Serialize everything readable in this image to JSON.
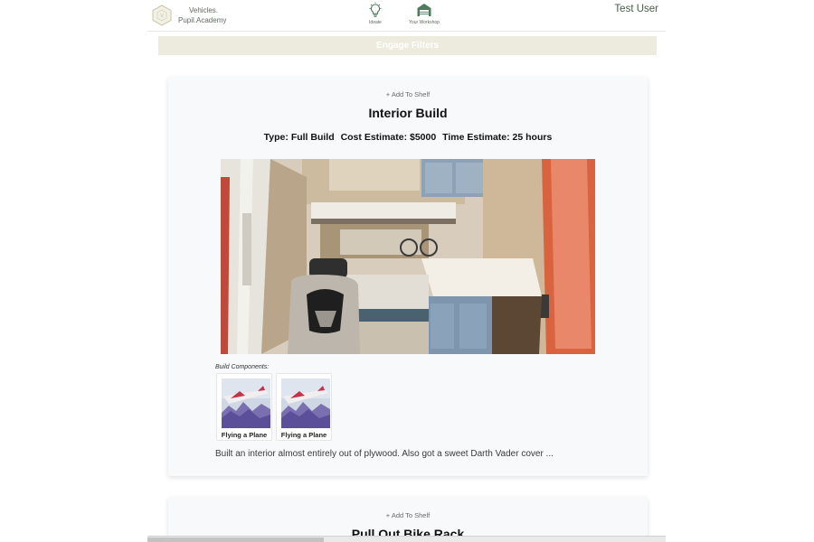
{
  "header": {
    "brand_line1": "Vehicles.",
    "brand_line2": "Pupil.Academy",
    "nav": [
      {
        "label": "Ideate",
        "icon": "lightbulb-icon"
      },
      {
        "label": "Your Workshop",
        "icon": "garage-icon"
      }
    ],
    "user_name": "Test User"
  },
  "filter_bar": {
    "label": "Engage Filters"
  },
  "builds": [
    {
      "add_to_shelf": "+ Add To Shelf",
      "title": "Interior Build",
      "type": "Type: Full Build",
      "cost": "Cost Estimate: $5000",
      "time": "Time Estimate: 25 hours",
      "photo": "van-interior-photo",
      "components_label": "Build Components:",
      "components": [
        {
          "name": "Flying a Plane",
          "thumb": "plane-photo"
        },
        {
          "name": "Flying a Plane",
          "thumb": "plane-photo"
        }
      ],
      "description": "Built an interior almost entirely out of plywood. Also got a sweet Darth Vader cover ..."
    },
    {
      "add_to_shelf": "+ Add To Shelf",
      "title": "Pull Out Bike Rack"
    }
  ],
  "colors": {
    "filter_bar_bg": "#ecebdd",
    "card_bg": "#f7f9fb",
    "accent_green": "#4e7a5e"
  }
}
